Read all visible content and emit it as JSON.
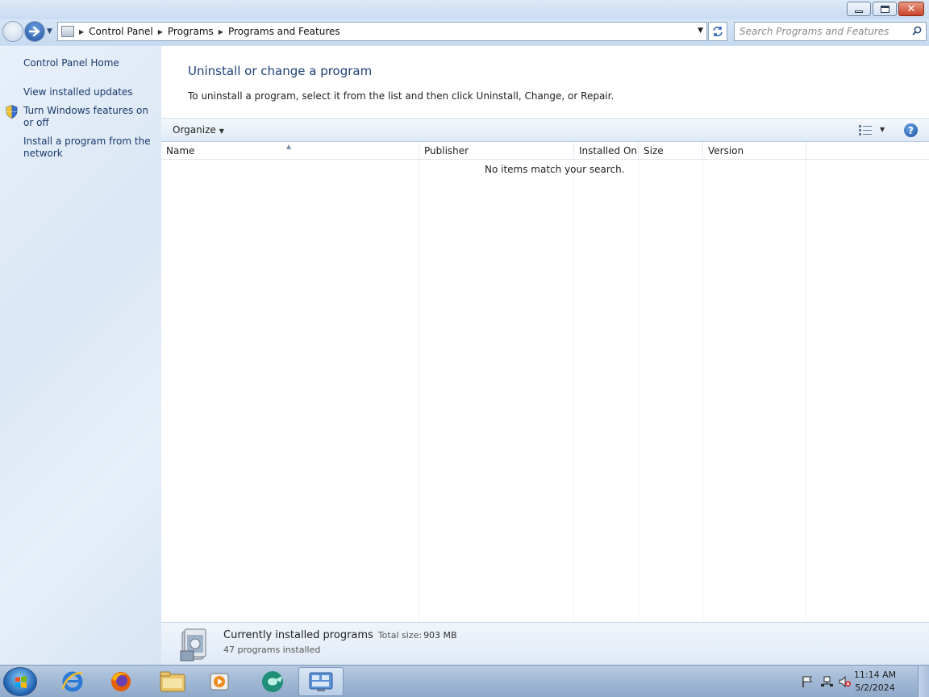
{
  "window": {
    "minimize_label": "",
    "close_label": "✕"
  },
  "address": {
    "breadcrumb": [
      "Control Panel",
      "Programs",
      "Programs and Features"
    ]
  },
  "search": {
    "placeholder": "Search Programs and Features"
  },
  "sidebar": {
    "items": [
      {
        "label": "Control Panel Home"
      },
      {
        "label": "View installed updates"
      },
      {
        "label": "Turn Windows features on or off"
      },
      {
        "label": "Install a program from the network"
      }
    ]
  },
  "main": {
    "title": "Uninstall or change a program",
    "description": "To uninstall a program, select it from the list and then click Uninstall, Change, or Repair."
  },
  "toolbar": {
    "organize_label": "Organize",
    "help_label": "?"
  },
  "table": {
    "columns": [
      "Name",
      "Publisher",
      "Installed On",
      "Size",
      "Version"
    ],
    "empty_message": "No items match your search."
  },
  "details": {
    "title": "Currently installed programs",
    "size_label": "Total size:",
    "size_value": "903 MB",
    "count": "47 programs installed"
  },
  "taskbar": {
    "apps": [
      "start-icon",
      "internet-explorer-icon",
      "firefox-icon",
      "file-explorer-icon",
      "media-player-icon",
      "app-icon",
      "control-panel-icon"
    ],
    "time": "11:14 AM",
    "date": "5/2/2024"
  },
  "colors": {
    "link": "#1a3a6b",
    "heading": "#1e3f7a",
    "close_button": "#c9432a"
  }
}
